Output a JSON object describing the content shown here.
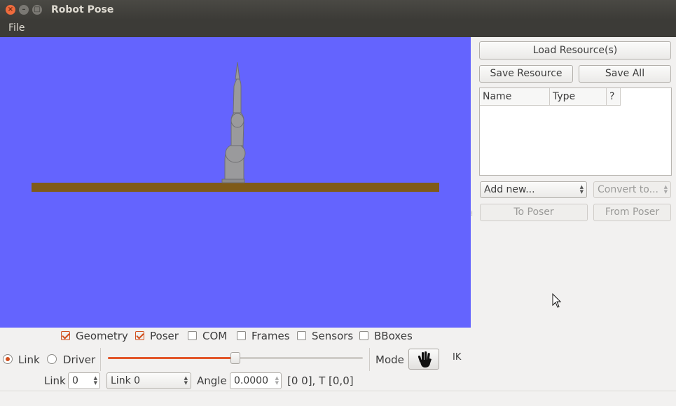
{
  "window": {
    "title": "Robot Pose"
  },
  "menu": {
    "file": "File"
  },
  "resources": {
    "load_label": "Load Resource(s)",
    "save_resource_label": "Save Resource",
    "save_all_label": "Save All",
    "columns": [
      "Name",
      "Type",
      "?"
    ],
    "add_new_value": "Add new...",
    "convert_to_value": "Convert to...",
    "to_poser_label": "To Poser",
    "from_poser_label": "From Poser"
  },
  "display_options": {
    "geometry": {
      "label": "Geometry",
      "checked": true
    },
    "poser": {
      "label": "Poser",
      "checked": true
    },
    "com": {
      "label": "COM",
      "checked": false
    },
    "frames": {
      "label": "Frames",
      "checked": false
    },
    "sensors": {
      "label": "Sensors",
      "checked": false
    },
    "bboxes": {
      "label": "BBoxes",
      "checked": false
    }
  },
  "controls": {
    "link_radio_label": "Link",
    "driver_radio_label": "Driver",
    "slider_value": 0.5,
    "mode_label": "Mode",
    "ik_label": "IK",
    "link_label": "Link",
    "link_index": "0",
    "link_select_value": "Link 0",
    "angle_label": "Angle",
    "angle_value": "0.0000",
    "info_text": "[0 0], T [0,0]"
  },
  "colors": {
    "viewport_bg": "#6464fe",
    "ground": "#7f5b18",
    "accent": "#e2562a"
  }
}
